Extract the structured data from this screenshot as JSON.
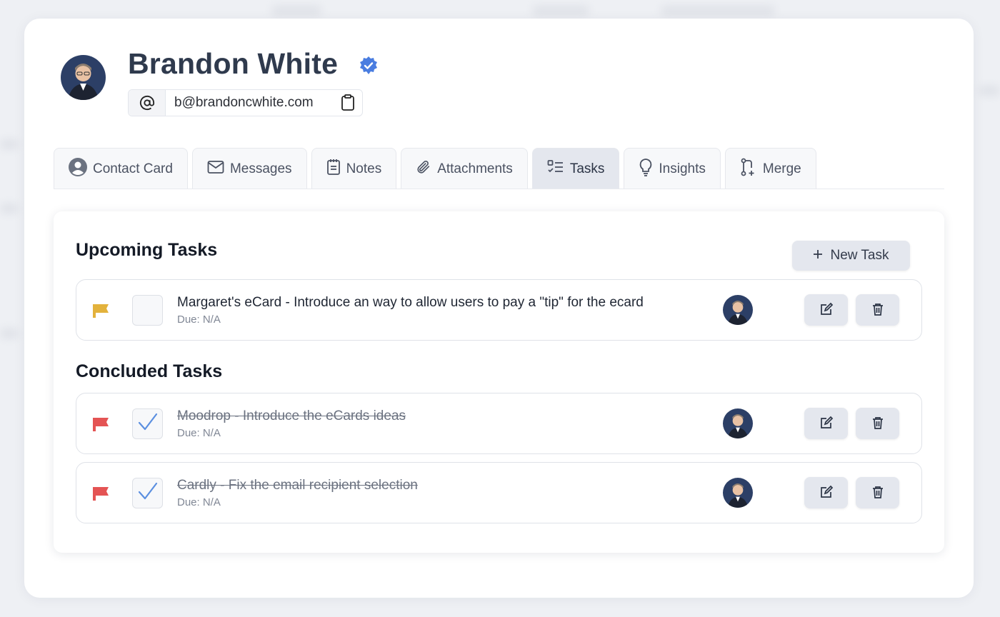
{
  "profile": {
    "name": "Brandon White",
    "email": "b@brandoncwhite.com"
  },
  "tabs": [
    {
      "label": "Contact Card",
      "icon": "user-circle-icon"
    },
    {
      "label": "Messages",
      "icon": "envelope-icon"
    },
    {
      "label": "Notes",
      "icon": "clipboard-icon"
    },
    {
      "label": "Attachments",
      "icon": "paperclip-icon"
    },
    {
      "label": "Tasks",
      "icon": "tasks-list-icon",
      "active": true
    },
    {
      "label": "Insights",
      "icon": "lightbulb-icon"
    },
    {
      "label": "Merge",
      "icon": "git-merge-icon"
    }
  ],
  "sections": {
    "upcoming_title": "Upcoming Tasks",
    "concluded_title": "Concluded Tasks",
    "new_task_label": "New Task"
  },
  "upcoming": [
    {
      "title": "Margaret's eCard - Introduce an way to allow users to pay a \"tip\" for the ecard",
      "due": "Due: N/A",
      "flag_color": "#e3b23c",
      "done": false
    }
  ],
  "concluded": [
    {
      "title": "Moodrop - Introduce the eCards ideas",
      "due": "Due: N/A",
      "flag_color": "#e45454",
      "done": true
    },
    {
      "title": "Cardly - Fix the email recipient selection",
      "due": "Due: N/A",
      "flag_color": "#e45454",
      "done": true
    }
  ],
  "colors": {
    "verified": "#4a7de0",
    "check": "#5b8fe0"
  }
}
